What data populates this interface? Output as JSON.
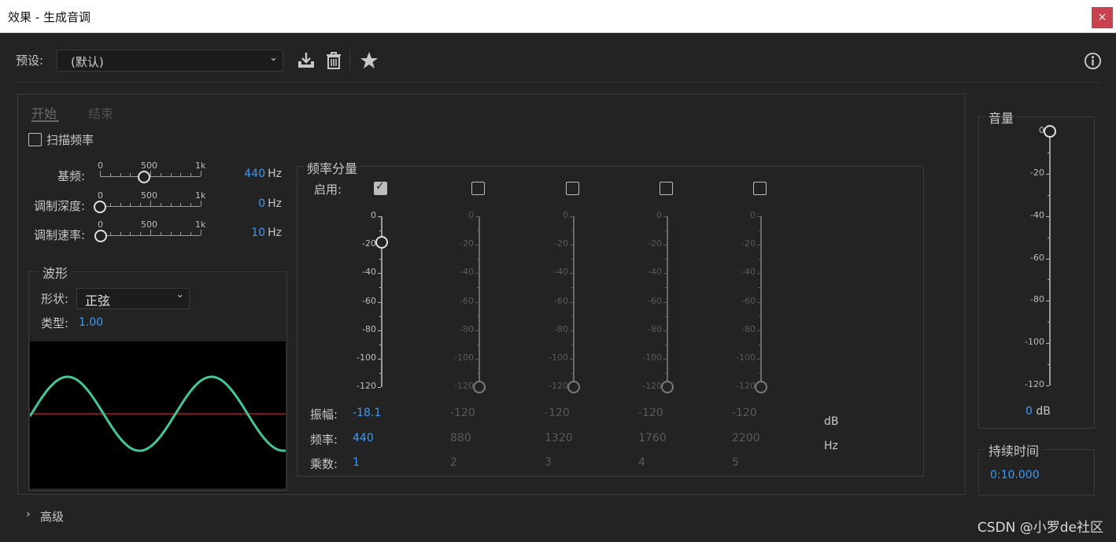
{
  "window": {
    "title": "效果 - 生成音调",
    "close": "×"
  },
  "preset": {
    "label": "预设:",
    "value": "(默认)"
  },
  "tabs": {
    "start": "开始",
    "end": "结束"
  },
  "sweep": {
    "label": "扫描频率"
  },
  "sliders": [
    {
      "label": "基频:",
      "t0": "0",
      "t1": "500",
      "t2": "1k",
      "value": "440",
      "unit": "Hz",
      "pos": 0.44
    },
    {
      "label": "调制深度:",
      "t0": "0",
      "t1": "500",
      "t2": "1k",
      "value": "0",
      "unit": "Hz",
      "pos": 0.0
    },
    {
      "label": "调制速率:",
      "t0": "0",
      "t1": "500",
      "t2": "1k",
      "value": "10",
      "unit": "Hz",
      "pos": 0.01
    }
  ],
  "waveform": {
    "title": "波形",
    "shape_label": "形状:",
    "shape_value": "正弦",
    "type_label": "类型:",
    "type_value": "1.00"
  },
  "components": {
    "title": "频率分量",
    "enable_label": "启用:",
    "scale": [
      "0",
      "-20",
      "-40",
      "-60",
      "-80",
      "-100",
      "-120"
    ],
    "amp_label": "振幅:",
    "freq_label": "频率:",
    "mult_label": "乘数:",
    "db_unit": "dB",
    "hz_unit": "Hz",
    "items": [
      {
        "enabled": true,
        "amp": "-18.1",
        "freq": "440",
        "mult": "1",
        "level": -18.1
      },
      {
        "enabled": false,
        "amp": "-120",
        "freq": "880",
        "mult": "2",
        "level": -120
      },
      {
        "enabled": false,
        "amp": "-120",
        "freq": "1320",
        "mult": "3",
        "level": -120
      },
      {
        "enabled": false,
        "amp": "-120",
        "freq": "1760",
        "mult": "4",
        "level": -120
      },
      {
        "enabled": false,
        "amp": "-120",
        "freq": "2200",
        "mult": "5",
        "level": -120
      }
    ]
  },
  "volume": {
    "title": "音量",
    "scale": [
      "0",
      "-20",
      "-40",
      "-60",
      "-80",
      "-100",
      "-120"
    ],
    "value": "0",
    "unit": "dB",
    "level": 0
  },
  "duration": {
    "title": "持续时间",
    "value": "0:10.000"
  },
  "advanced": {
    "label": "高级"
  },
  "watermark": "CSDN @小罗de社区"
}
